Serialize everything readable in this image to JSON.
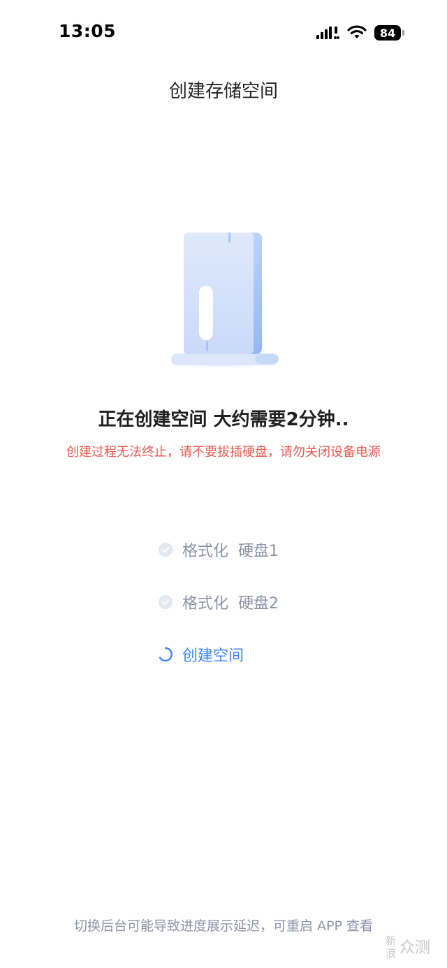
{
  "status_bar": {
    "time": "13:05",
    "battery_level": "84",
    "icons": [
      "signal-icon",
      "wifi-icon",
      "battery-icon"
    ]
  },
  "header": {
    "title": "创建存储空间"
  },
  "illustration": {
    "icon": "storage-device-icon"
  },
  "progress": {
    "message": "正在创建空间 大约需要2分钟..",
    "warning": "创建过程无法终止，请不要拔插硬盘，请勿关闭设备电源"
  },
  "steps": [
    {
      "label": "格式化  硬盘1",
      "status": "done",
      "icon": "check-circle-icon"
    },
    {
      "label": "格式化  硬盘2",
      "status": "done",
      "icon": "check-circle-icon"
    },
    {
      "label": "创建空间",
      "status": "in-progress",
      "icon": "spinner-icon"
    }
  ],
  "footer": {
    "note": "切换后台可能导致进度展示延迟，可重启 APP 查看"
  },
  "watermark": {
    "text": "新浪众测"
  },
  "colors": {
    "accent": "#3e86f5",
    "warning": "#e85a4f",
    "muted": "#8e92a6",
    "illustration": "#dbe7fb"
  }
}
